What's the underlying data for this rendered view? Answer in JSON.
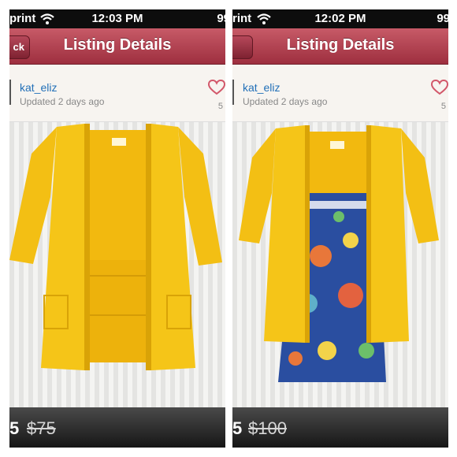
{
  "colors": {
    "nav": "#a93546",
    "username": "#2270b8",
    "sweater": "#f5c518",
    "top_blue": "#2a4ea0"
  },
  "panels": [
    {
      "status": {
        "carrier": "print",
        "time": "12:03 PM",
        "battery": "99"
      },
      "nav": {
        "back_label": "ck",
        "title": "Listing Details"
      },
      "listing": {
        "username": "kat_eliz",
        "updated": "Updated 2 days ago",
        "likes": "5"
      },
      "price": {
        "current": "5",
        "original": "$75"
      }
    },
    {
      "status": {
        "carrier": "rint",
        "time": "12:02 PM",
        "battery": "99"
      },
      "nav": {
        "back_label": "",
        "title": "Listing Details"
      },
      "listing": {
        "username": "kat_eliz",
        "updated": "Updated 2 days ago",
        "likes": "5"
      },
      "price": {
        "current": "5",
        "original": "$100"
      }
    }
  ],
  "icons": {
    "wifi": "wifi-icon",
    "heart": "heart-icon"
  }
}
